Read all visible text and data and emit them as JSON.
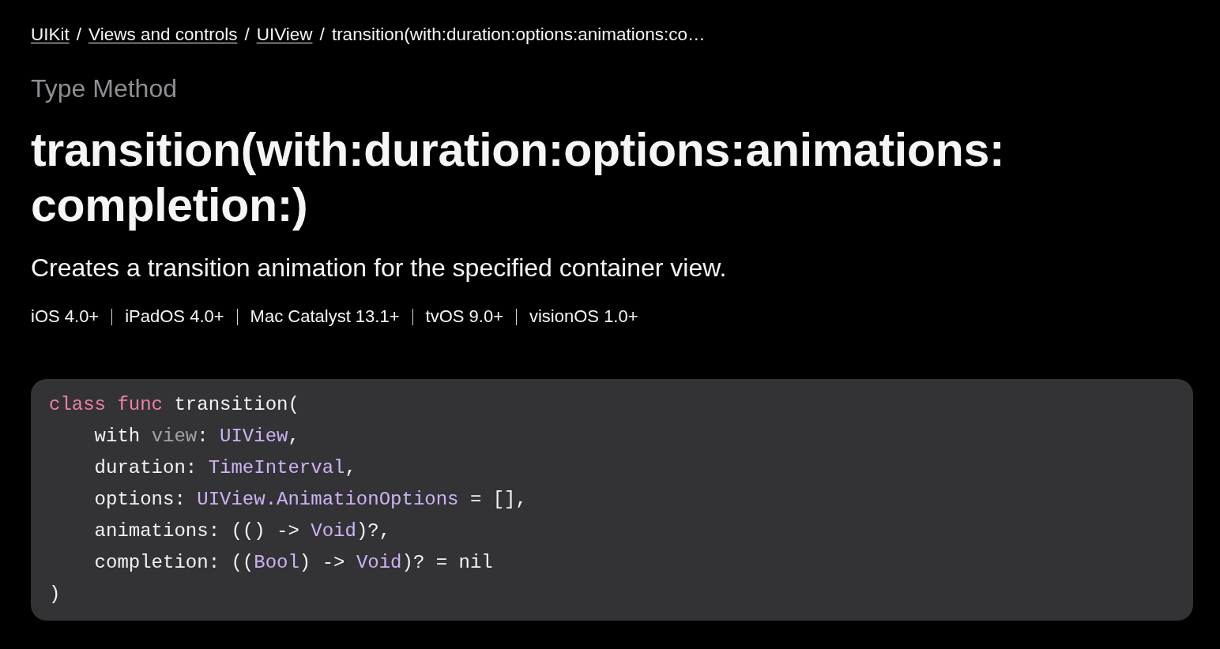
{
  "breadcrumb": [
    {
      "label": "UIKit",
      "kind": "link",
      "separator": "/"
    },
    {
      "label": "Views and controls",
      "kind": "link",
      "separator": "/"
    },
    {
      "label": "UIView",
      "kind": "link",
      "separator": "/"
    },
    {
      "label": "transition(with:duration:options:animations:co…",
      "kind": "current"
    }
  ],
  "eyebrow": "Type Method",
  "title": "transition(with:duration:options:animations:completion:)",
  "abstract": "Creates a transition animation for the specified container view.",
  "platforms": [
    "iOS 4.0+",
    "iPadOS 4.0+",
    "Mac Catalyst 13.1+",
    "tvOS 9.0+",
    "visionOS 1.0+"
  ],
  "declaration": {
    "lines": [
      {
        "tokens": [
          {
            "text": "class func",
            "kind": "keyword"
          },
          {
            "text": " transition(",
            "kind": "plain"
          }
        ],
        "children": [
          {
            "tokens": [
              {
                "text": "with ",
                "kind": "plain"
              },
              {
                "text": "view",
                "kind": "param"
              },
              {
                "text": ": ",
                "kind": "plain"
              },
              {
                "text": "UIView",
                "kind": "type"
              },
              {
                "text": ",",
                "kind": "plain"
              }
            ]
          },
          {
            "tokens": [
              {
                "text": "duration: ",
                "kind": "plain"
              },
              {
                "text": "TimeInterval",
                "kind": "type"
              },
              {
                "text": ",",
                "kind": "plain"
              }
            ]
          },
          {
            "tokens": [
              {
                "text": "options: ",
                "kind": "plain"
              },
              {
                "text": "UIView.AnimationOptions",
                "kind": "type"
              },
              {
                "text": " = [],",
                "kind": "plain"
              }
            ]
          },
          {
            "tokens": [
              {
                "text": "animations: (() -> ",
                "kind": "plain"
              },
              {
                "text": "Void",
                "kind": "type"
              },
              {
                "text": ")?,",
                "kind": "plain"
              }
            ]
          },
          {
            "tokens": [
              {
                "text": "completion: ((",
                "kind": "plain"
              },
              {
                "text": "Bool",
                "kind": "type"
              },
              {
                "text": ") -> ",
                "kind": "plain"
              },
              {
                "text": "Void",
                "kind": "type"
              },
              {
                "text": ")? = nil",
                "kind": "plain"
              }
            ]
          }
        ]
      },
      {
        "tokens": [
          {
            "text": ")",
            "kind": "plain"
          }
        ]
      }
    ]
  }
}
